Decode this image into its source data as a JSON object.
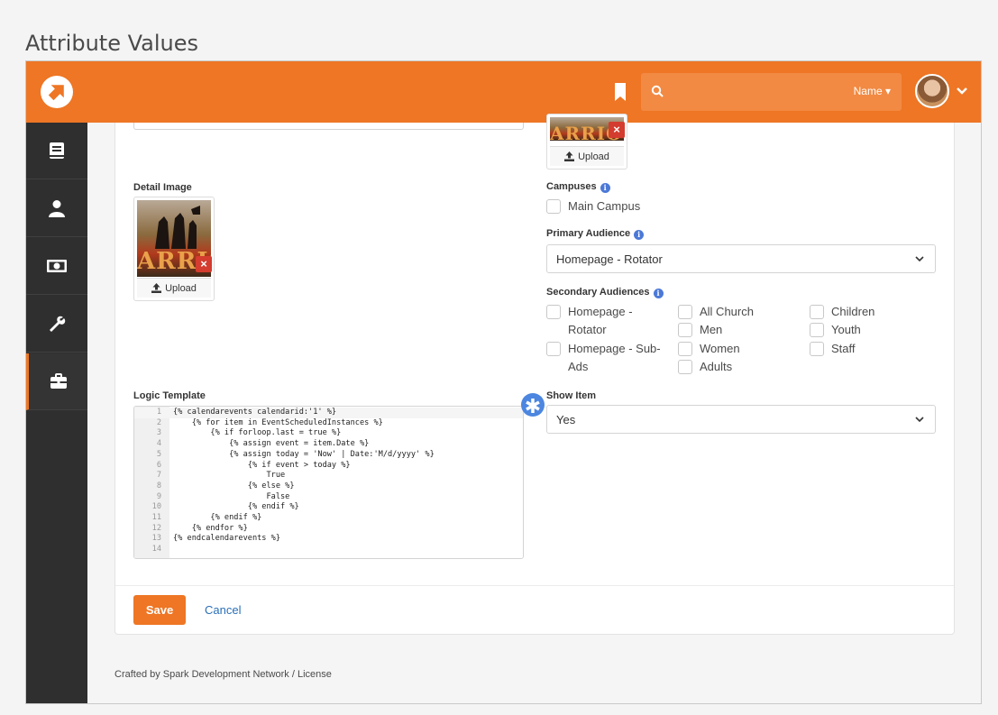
{
  "page": {
    "heading": "Attribute Values"
  },
  "header": {
    "search": {
      "placeholder": "",
      "scope_label": "Name",
      "scope_caret": "▾"
    }
  },
  "sidebar": {
    "items": [
      {
        "name": "book-icon"
      },
      {
        "name": "person-icon"
      },
      {
        "name": "money-icon"
      },
      {
        "name": "wrench-icon"
      },
      {
        "name": "briefcase-icon",
        "active": true
      }
    ]
  },
  "form": {
    "detail_image": {
      "label": "Detail Image",
      "upload_label": "Upload",
      "image_text": "ARRIO"
    },
    "top_image": {
      "upload_label": "Upload",
      "image_text": "ARRIO"
    },
    "campuses": {
      "label": "Campuses",
      "options": [
        "Main Campus"
      ]
    },
    "primary_audience": {
      "label": "Primary Audience",
      "value": "Homepage - Rotator"
    },
    "secondary_audiences": {
      "label": "Secondary Audiences",
      "col1": [
        "Homepage - Rotator",
        "Homepage - Sub-Ads"
      ],
      "col2": [
        "All Church",
        "Men",
        "Women",
        "Adults"
      ],
      "col3": [
        "Children",
        "Youth",
        "Staff"
      ]
    },
    "logic_template": {
      "label": "Logic Template",
      "lines": [
        "{% calendarevents calendarid:'1' %}",
        "    {% for item in EventScheduledInstances %}",
        "        {% if forloop.last = true %}",
        "            {% assign event = item.Date %}",
        "            {% assign today = 'Now' | Date:'M/d/yyyy' %}",
        "                {% if event > today %}",
        "                    True",
        "                {% else %}",
        "                    False",
        "                {% endif %}",
        "        {% endif %}",
        "    {% endfor %}",
        "{% endcalendarevents %}",
        ""
      ]
    },
    "show_item": {
      "label": "Show Item",
      "value": "Yes"
    },
    "required_marker": "✱"
  },
  "actions": {
    "save_label": "Save",
    "cancel_label": "Cancel"
  },
  "footer": {
    "credit": "Crafted by Spark Development Network / License"
  },
  "colors": {
    "brand": "#ee7624",
    "sidebar": "#2f2f2f",
    "link": "#2a6fb8",
    "info": "#4c79d7"
  }
}
